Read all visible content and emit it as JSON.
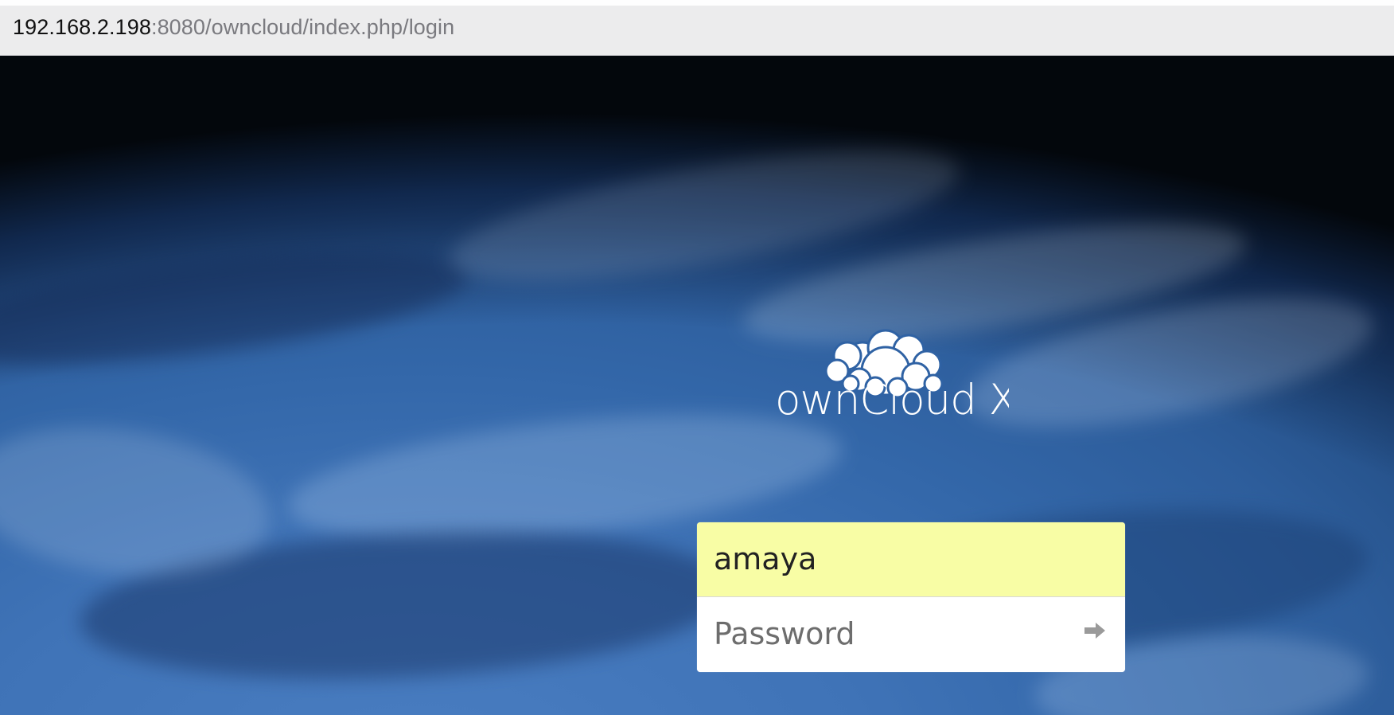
{
  "browser": {
    "url": {
      "host": "192.168.2.198",
      "rest": ":8080/owncloud/index.php/login"
    }
  },
  "brand": {
    "logo_text": "ownCloud X",
    "logo_icon": "owncloud-logo-icon"
  },
  "login": {
    "username_value": "amaya",
    "password_placeholder": "Password",
    "submit_icon": "arrow-right-icon"
  },
  "colors": {
    "address_bar": "#ececed",
    "background_blue": "#2f62a4",
    "autofill_yellow": "#f8fda5",
    "field_white": "#ffffff",
    "placeholder_gray": "#6d6d6d",
    "arrow_gray": "#9a9a9a"
  }
}
